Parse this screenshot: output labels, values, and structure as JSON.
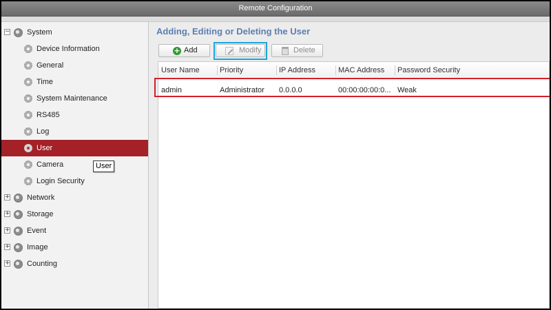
{
  "window": {
    "title": "Remote Configuration"
  },
  "sidebar": {
    "categories": [
      {
        "label": "System",
        "expander": "−"
      },
      {
        "label": "Network",
        "expander": "+"
      },
      {
        "label": "Storage",
        "expander": "+"
      },
      {
        "label": "Event",
        "expander": "+"
      },
      {
        "label": "Image",
        "expander": "+"
      },
      {
        "label": "Counting",
        "expander": "+"
      }
    ],
    "system_items": [
      {
        "label": "Device Information"
      },
      {
        "label": "General"
      },
      {
        "label": "Time"
      },
      {
        "label": "System Maintenance"
      },
      {
        "label": "RS485"
      },
      {
        "label": "Log"
      },
      {
        "label": "User",
        "selected": true
      },
      {
        "label": "Camera"
      },
      {
        "label": "Login Security"
      }
    ],
    "tooltip": "User",
    "selected_color": "#a32127"
  },
  "main": {
    "title": "Adding, Editing or Deleting the User",
    "title_color": "#5b7fb0",
    "toolbar": {
      "add_label": "Add",
      "modify_label": "Modify",
      "delete_label": "Delete",
      "add_icon": "plus-circle-icon",
      "modify_icon": "edit-icon",
      "delete_icon": "trash-icon"
    },
    "table": {
      "columns": [
        "User Name",
        "Priority",
        "IP Address",
        "MAC Address",
        "Password Security"
      ],
      "rows": [
        [
          "admin",
          "Administrator",
          "0.0.0.0",
          "00:00:00:00:0...",
          "Weak"
        ]
      ]
    },
    "highlight_color": "#d21f2b",
    "focus_color": "#1aa3dc"
  }
}
